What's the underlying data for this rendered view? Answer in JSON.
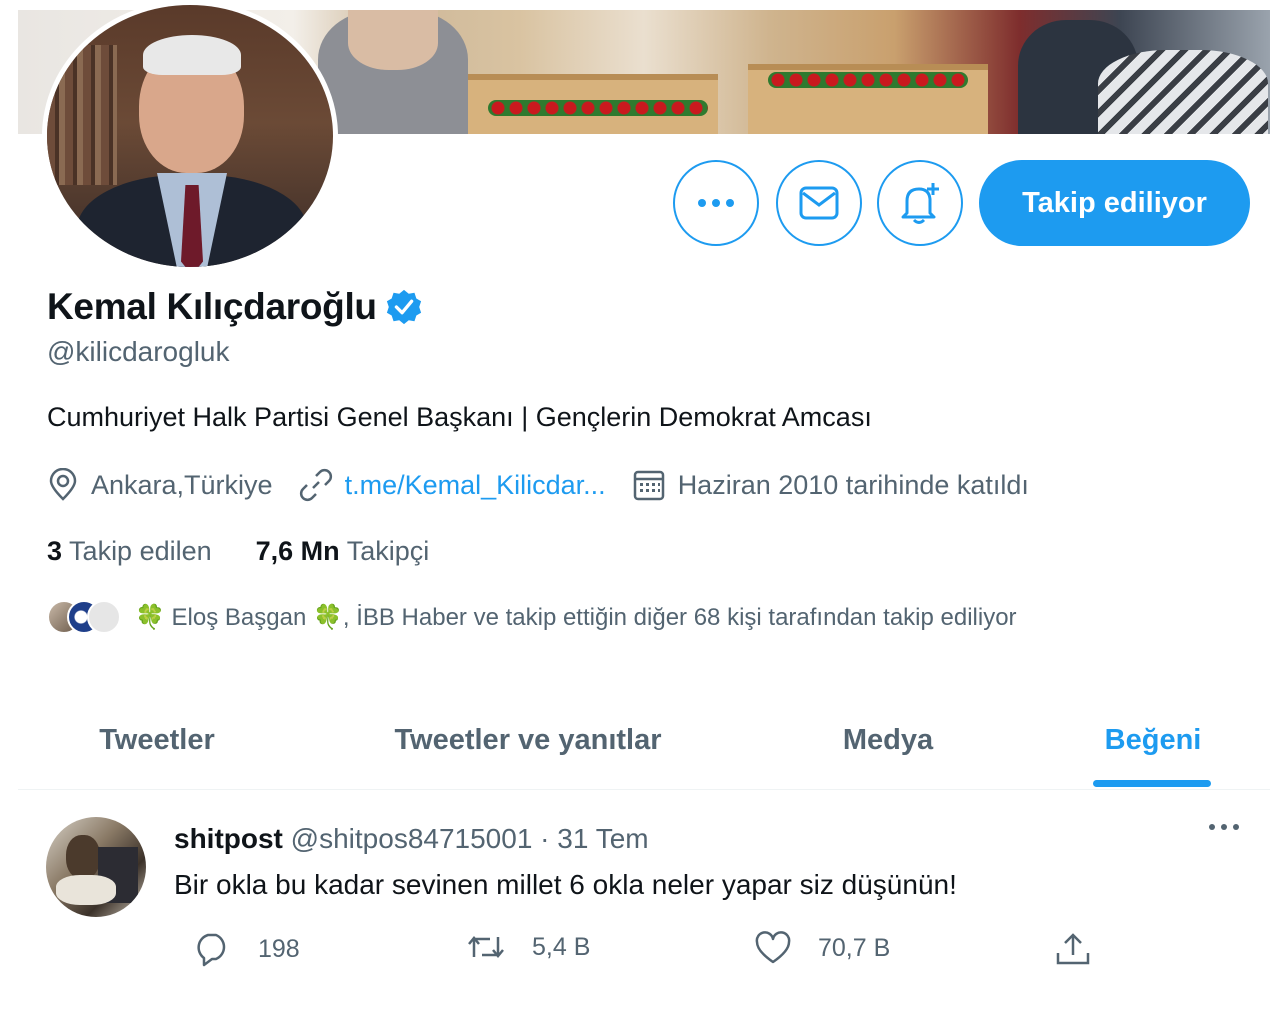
{
  "profile": {
    "name": "Kemal Kılıçdaroğlu",
    "handle": "@kilicdarogluk",
    "bio": "Cumhuriyet Halk Partisi Genel Başkanı | Gençlerin Demokrat Amcası",
    "location": "Ankara,Türkiye",
    "link": "t.me/Kemal_Kilicdar...",
    "joined": "Haziran 2010 tarihinde katıldı",
    "following_count": "3",
    "following_label": "Takip edilen",
    "followers_count": "7,6 Mn",
    "followers_label": "Takipçi",
    "followed_by": "🍀 Eloş Başgan 🍀, İBB Haber ve takip ettiğin diğer 68 kişi tarafından takip ediliyor"
  },
  "actions": {
    "follow_label": "Takip ediliyor"
  },
  "tabs": [
    {
      "label": "Tweetler"
    },
    {
      "label": "Tweetler ve yanıtlar"
    },
    {
      "label": "Medya"
    },
    {
      "label": "Beğeni"
    }
  ],
  "tweet": {
    "author": "shitpost",
    "handle": "@shitpos84715001",
    "date": "· 31 Tem",
    "text": "Bir okla bu kadar sevinen millet 6 okla neler yapar siz düşünün!",
    "replies": "198",
    "retweets": "5,4 B",
    "likes": "70,7 B"
  },
  "colors": {
    "accent": "#1d9bf0",
    "text_primary": "#0f1419",
    "text_secondary": "#536471"
  },
  "icons": [
    "more-icon",
    "mail-icon",
    "notification-bell-icon",
    "verified-badge-icon",
    "location-icon",
    "link-icon",
    "calendar-icon",
    "reply-icon",
    "retweet-icon",
    "like-icon",
    "share-icon"
  ]
}
